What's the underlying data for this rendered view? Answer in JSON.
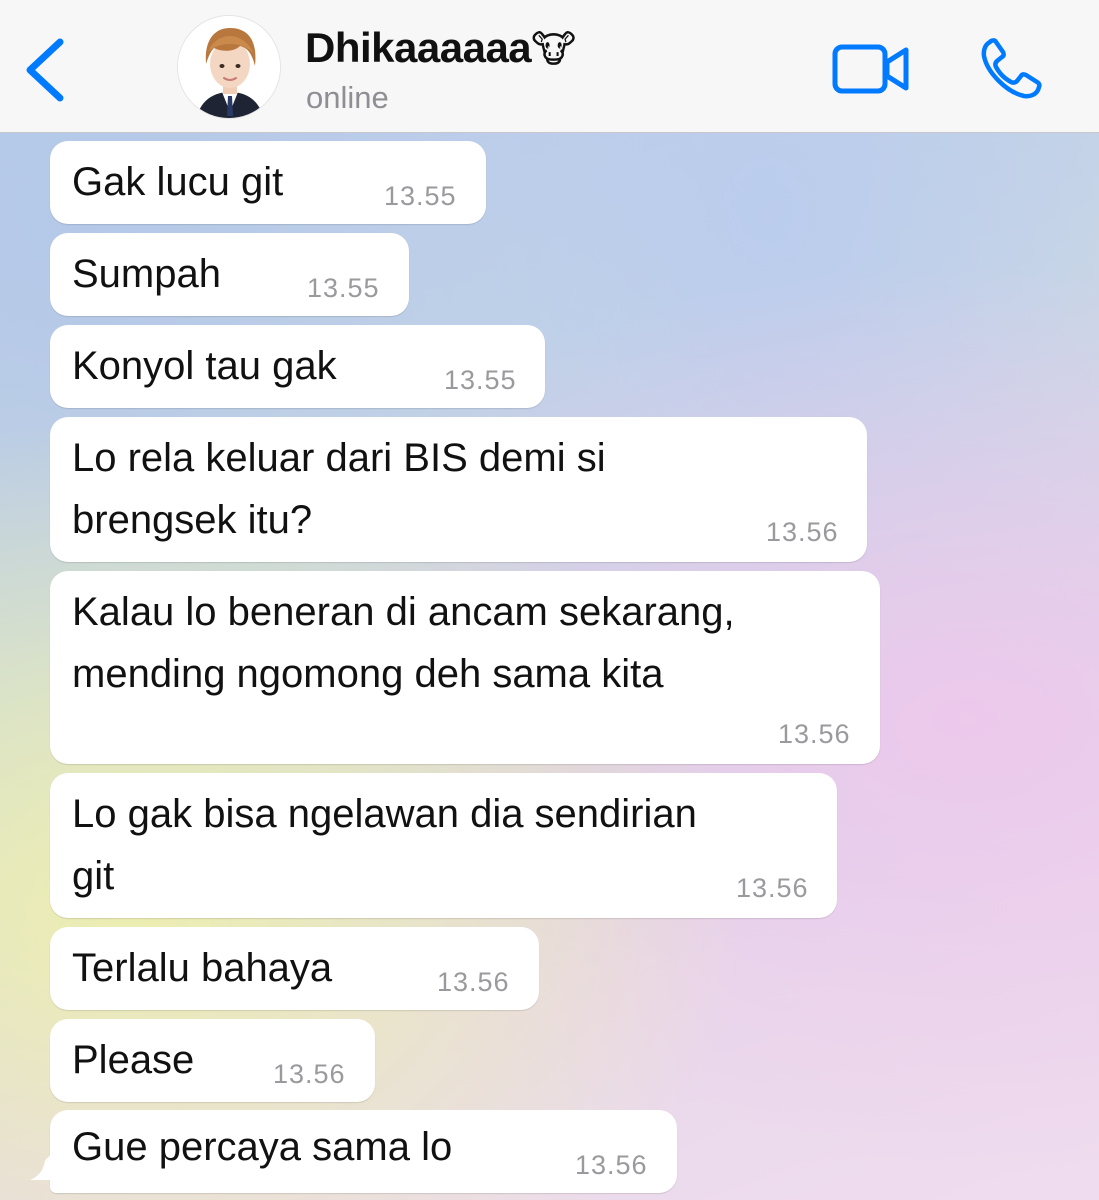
{
  "header": {
    "contact_name": "Dhikaaaaaa",
    "contact_emoji": "🐮",
    "status": "online",
    "accent_color": "#007aff"
  },
  "icons": [
    "chevron-left-icon",
    "avatar",
    "video-camera-icon",
    "phone-icon"
  ],
  "messages": [
    {
      "text": "Gak lucu git",
      "time": "13.55"
    },
    {
      "text": "Sumpah",
      "time": "13.55"
    },
    {
      "text": "Konyol tau gak",
      "time": "13.55"
    },
    {
      "lines": [
        "Lo rela keluar dari BIS demi si",
        "brengsek itu?"
      ],
      "time": "13.56"
    },
    {
      "lines": [
        "Kalau lo beneran di ancam sekarang,",
        "mending ngomong deh sama kita"
      ],
      "time": "13.56"
    },
    {
      "lines": [
        "Lo gak bisa ngelawan dia sendirian",
        "git"
      ],
      "time": "13.56"
    },
    {
      "text": "Terlalu bahaya",
      "time": "13.56"
    },
    {
      "text": "Please",
      "time": "13.56"
    },
    {
      "text": "Gue percaya sama lo",
      "time": "13.56"
    }
  ]
}
